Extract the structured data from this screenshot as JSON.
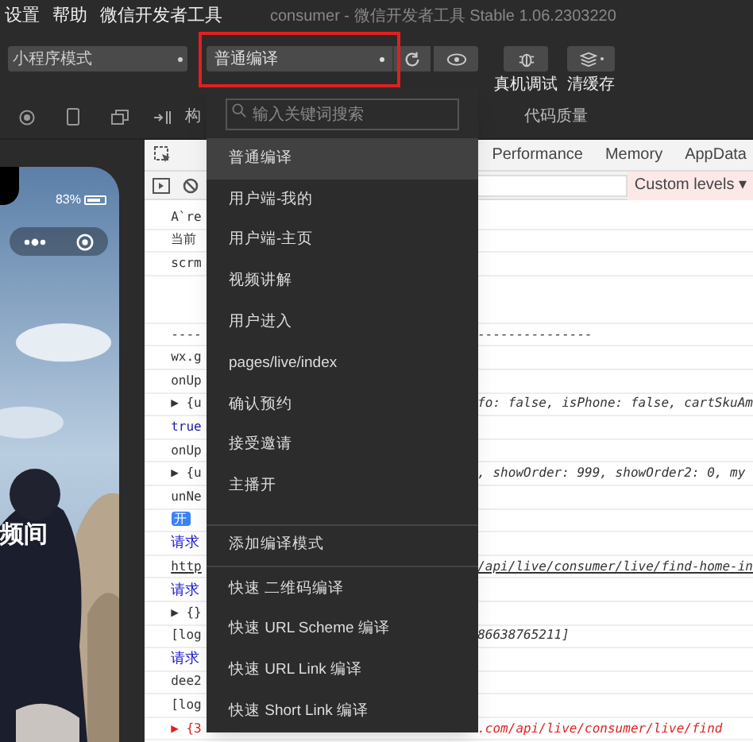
{
  "menu": [
    "设置",
    "帮助",
    "微信开发者工具"
  ],
  "window": {
    "title": "consumer - 微信开发者工具 Stable 1.06.2303220"
  },
  "toolbar": {
    "mode": "小程序模式",
    "compile": "普通编译",
    "debug_label": "真机调试",
    "cache_label": "清缓存",
    "highlighted": true
  },
  "devtools_tabs": [
    {
      "label": "构",
      "selected": false
    },
    {
      "label": "代码质量",
      "selected": false
    }
  ],
  "panel_tabs": [
    "Performance",
    "Memory",
    "AppData"
  ],
  "levels": "Custom levels ▾",
  "simulator": {
    "battery": "83%",
    "headline": "频间"
  },
  "console": [
    {
      "left": "A`re",
      "kind": "plain"
    },
    {
      "left": "当前",
      "kind": "plain"
    },
    {
      "left": "scrm",
      "kind": "plain"
    },
    {
      "kind": "blank"
    },
    {
      "left": "----",
      "right": "---------------",
      "kind": "plain"
    },
    {
      "left": "wx.g",
      "kind": "plain"
    },
    {
      "left": "onUp",
      "kind": "plain"
    },
    {
      "left": "▶ {u",
      "right": "fo: false, isPhone: false, cartSkuAm",
      "kind": "object"
    },
    {
      "left": "true",
      "kind": "keyword"
    },
    {
      "left": "onUp",
      "kind": "plain"
    },
    {
      "left": "▶ {u",
      "right": ", showOrder: 999, showOrder2: 0, my",
      "kind": "object"
    },
    {
      "left": "unNe",
      "kind": "plain"
    },
    {
      "left": "开",
      "kind": "badge"
    },
    {
      "left": "请求",
      "kind": "request"
    },
    {
      "left": "http",
      "right": "/api/live/consumer/live/find-home-in",
      "kind": "link"
    },
    {
      "left": "请求",
      "kind": "request"
    },
    {
      "left": "▶ {}",
      "kind": "object"
    },
    {
      "left": "[log",
      "right": "86638765211]",
      "kind": "object"
    },
    {
      "left": "请求",
      "kind": "request"
    },
    {
      "left": "dee2",
      "kind": "plain"
    },
    {
      "left": "[log",
      "kind": "plain"
    },
    {
      "left": "▶ {3",
      "right": ".com/api/live/consumer/live/find",
      "kind": "error"
    }
  ],
  "dropdown": {
    "placeholder": "输入关键词搜索",
    "items": [
      {
        "label": "普通编译",
        "selected": true
      },
      {
        "label": "用户端-我的",
        "selected": false
      },
      {
        "label": "用户端-主页",
        "selected": false
      },
      {
        "label": "视频讲解",
        "selected": false
      },
      {
        "label": "用户进入",
        "selected": false
      },
      {
        "label": "pages/live/index",
        "selected": false
      },
      {
        "label": "确认预约",
        "selected": false
      },
      {
        "label": "接受邀请",
        "selected": false
      },
      {
        "label": "主播开",
        "selected": false
      }
    ],
    "add": "添加编译模式",
    "quick": [
      "快速 二维码编译",
      "快速 URL Scheme 编译",
      "快速 URL Link 编译",
      "快速 Short Link 编译"
    ]
  }
}
